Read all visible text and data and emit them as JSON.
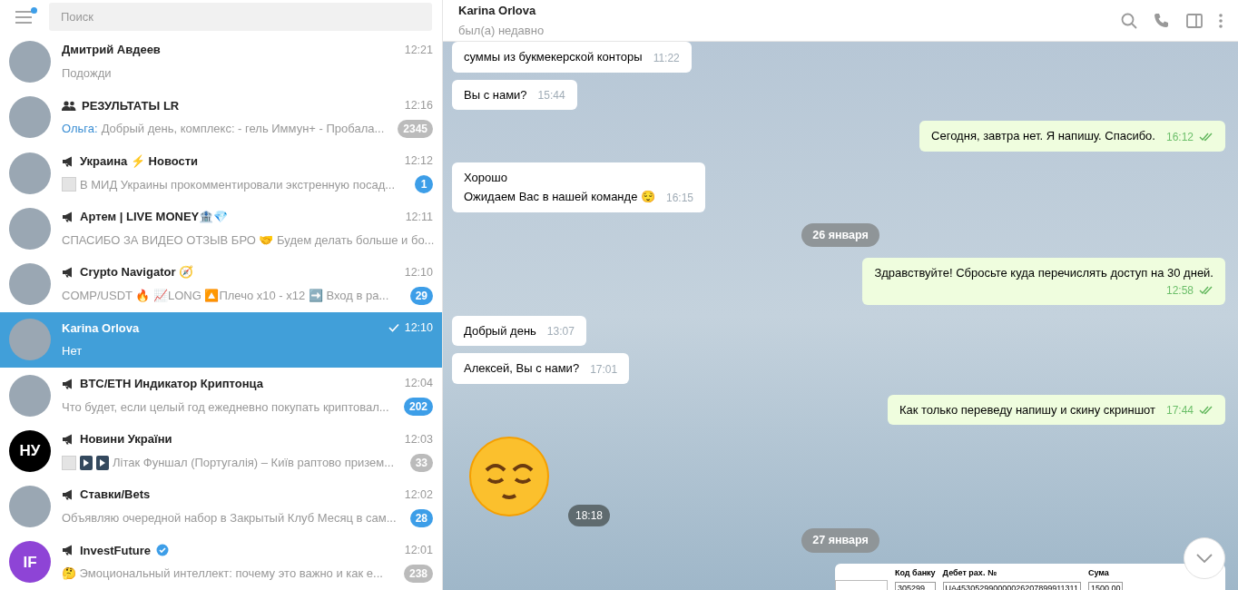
{
  "sidebar": {
    "search": {
      "placeholder": "Поиск"
    },
    "menu_badge": true,
    "chats": [
      {
        "name": "Дмитрий Авдеев",
        "kind": "user",
        "time": "12:21",
        "preview": "Подожди",
        "avatar": {
          "kind": "photo"
        },
        "selected": false
      },
      {
        "name": "РЕЗУЛЬТАТЫ LR",
        "kind": "group",
        "time": "12:16",
        "sender": "Ольга:",
        "preview": "Добрый день, комплекс:  - гель Иммун+ - Пробала...",
        "unread": "2345",
        "muted": true,
        "avatar": {
          "kind": "photo"
        },
        "selected": false
      },
      {
        "name": "Украина ⚡ Новости",
        "kind": "channel",
        "time": "12:12",
        "thumbs": [
          {
            "kind": "document"
          }
        ],
        "preview": "В МИД Украины прокомментировали экстренную посад...",
        "unread": "1",
        "muted": false,
        "avatar": {
          "kind": "photo"
        },
        "selected": false
      },
      {
        "name": "Артем | LIVE MONEY🏦💎",
        "kind": "channel",
        "time": "12:11",
        "preview": "СПАСИБО ЗА ВИДЕО ОТЗЫВ БРО 🤝  Будем делать больше и бо...",
        "avatar": {
          "kind": "photo"
        },
        "selected": false
      },
      {
        "name": "Crypto Navigator 🧭",
        "kind": "channel",
        "time": "12:10",
        "preview": "COMP/USDT 🔥  📈LONG 🔼Плечо x10 - x12  ➡️ Вход в ра...",
        "unread": "29",
        "muted": false,
        "avatar": {
          "kind": "photo"
        },
        "selected": false
      },
      {
        "name": "Karina Orlova",
        "kind": "user",
        "time": "12:10",
        "sent_check": true,
        "preview": "Нет",
        "avatar": {
          "kind": "photo"
        },
        "selected": true
      },
      {
        "name": "BTC/ETH Индикатор Криптонца",
        "kind": "channel",
        "time": "12:04",
        "preview": "Что будет, если целый год ежедневно покупать криптовал...",
        "unread": "202",
        "muted": false,
        "avatar": {
          "kind": "photo"
        },
        "selected": false
      },
      {
        "name": "Новини України",
        "kind": "channel",
        "time": "12:03",
        "thumbs": [
          {
            "kind": "document"
          },
          {
            "kind": "video"
          },
          {
            "kind": "video"
          }
        ],
        "preview": "Літак Фуншал (Португалія) – Київ раптово призем...",
        "unread": "33",
        "muted": true,
        "avatar": {
          "kind": "letters",
          "text": "НУ",
          "color": "#000000"
        },
        "selected": false
      },
      {
        "name": "Ставки/Bets",
        "kind": "channel",
        "time": "12:02",
        "preview": "Объявляю очередной набор в Закрытый Клуб  Месяц в сам...",
        "unread": "28",
        "muted": false,
        "avatar": {
          "kind": "photo"
        },
        "selected": false
      },
      {
        "name": "InvestFuture",
        "kind": "channel",
        "verified": true,
        "time": "12:01",
        "preview": "🤔 Эмоциональный интеллект: почему это важно и как е...",
        "unread": "238",
        "muted": true,
        "avatar": {
          "kind": "letters",
          "text": "IF",
          "color": "#8e44d6"
        },
        "selected": false
      }
    ]
  },
  "chat": {
    "title": "Karina Orlova",
    "status": "был(а) недавно",
    "messages": [
      {
        "kind": "incoming",
        "text": "суммы из букмекерской конторы",
        "time": "11:22"
      },
      {
        "kind": "incoming",
        "text": "Вы с нами?",
        "time": "15:44"
      },
      {
        "kind": "outgoing",
        "text": "Сегодня, завтра нет. Я напишу. Спасибо.",
        "time": "16:12",
        "read": true
      },
      {
        "kind": "incoming",
        "lines": [
          "Хорошо",
          "Ожидаем Вас в нашей команде 😌"
        ],
        "time": "16:15"
      },
      {
        "kind": "date",
        "text": "26 января"
      },
      {
        "kind": "outgoing",
        "text": "Здравствуйте! Сбросьте куда перечислять доступ на 30 дней.",
        "time": "12:58",
        "read": true,
        "time_below": true
      },
      {
        "kind": "incoming",
        "text": "Добрый день",
        "time": "13:07"
      },
      {
        "kind": "incoming",
        "text": "Алексей, Вы с нами?",
        "time": "17:01"
      },
      {
        "kind": "outgoing",
        "text": "Как только переведу напишу и скину скриншот",
        "time": "17:44",
        "read": true
      },
      {
        "kind": "sticker",
        "time": "18:18"
      },
      {
        "kind": "date",
        "text": "27 января"
      },
      {
        "kind": "document",
        "fields": [
          {
            "label": "Код банку",
            "value": "305299"
          },
          {
            "label": "Дебет рах. №",
            "value": "UA453052990000026207899911311"
          },
          {
            "label": "Сума",
            "value": "1500.00"
          }
        ]
      }
    ]
  }
}
